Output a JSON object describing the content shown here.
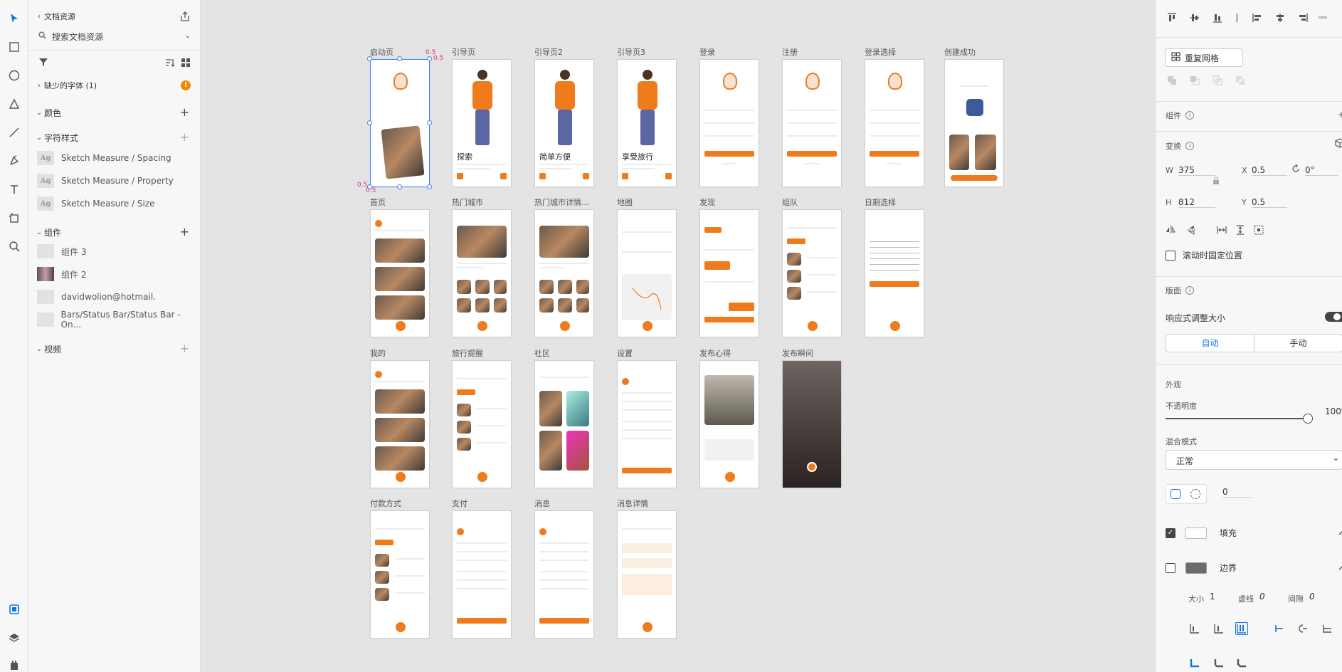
{
  "left_panel": {
    "header_title": "文档资源",
    "search_placeholder": "搜索文档资源",
    "missing_fonts": "缺少的字体 (1)",
    "missing_badge": "!",
    "colors_section": "颜色",
    "text_styles_section": "字符样式",
    "text_styles": [
      "Sketch Measure / Spacing",
      "Sketch Measure / Property",
      "Sketch Measure / Size"
    ],
    "text_style_thumb": "Ag",
    "components_section": "组件",
    "components": [
      "组件 3",
      "组件 2",
      "davidwolion@hotmail.",
      "Bars/Status Bar/Status Bar - On..."
    ],
    "video_section": "视频"
  },
  "canvas": {
    "artboards": [
      {
        "label": "启动页",
        "kind": "splash"
      },
      {
        "label": "引导页",
        "kind": "guide",
        "title": "探索"
      },
      {
        "label": "引导页2",
        "kind": "guide",
        "title": "简单方便"
      },
      {
        "label": "引导页3",
        "kind": "guide",
        "title": "享受旅行"
      },
      {
        "label": "登录",
        "kind": "login"
      },
      {
        "label": "注册",
        "kind": "login"
      },
      {
        "label": "登录选择",
        "kind": "login"
      },
      {
        "label": "创建成功",
        "kind": "success"
      },
      {
        "label": "首页",
        "kind": "feed"
      },
      {
        "label": "热门城市",
        "kind": "grid"
      },
      {
        "label": "热门城市详情...",
        "kind": "detail"
      },
      {
        "label": "地图",
        "kind": "map"
      },
      {
        "label": "发现",
        "kind": "discover"
      },
      {
        "label": "组队",
        "kind": "list"
      },
      {
        "label": "日期选择",
        "kind": "calendar"
      },
      {
        "label": "我的",
        "kind": "profile"
      },
      {
        "label": "旅行提醒",
        "kind": "list"
      },
      {
        "label": "社区",
        "kind": "community"
      },
      {
        "label": "设置",
        "kind": "settings"
      },
      {
        "label": "发布心得",
        "kind": "post"
      },
      {
        "label": "发布瞬间",
        "kind": "camera"
      },
      {
        "label": "付款方式",
        "kind": "list"
      },
      {
        "label": "支付",
        "kind": "settings"
      },
      {
        "label": "消息",
        "kind": "settings"
      },
      {
        "label": "消息详情",
        "kind": "chat"
      }
    ],
    "selection_labels": {
      "top": "0.5",
      "corner": "0.5",
      "left": "0.5",
      "bottom": "0.5"
    }
  },
  "right_panel": {
    "repeat_grid": "重复网格",
    "component_label": "组件",
    "transform_label": "变换",
    "w_label": "W",
    "w_value": "375",
    "x_label": "X",
    "x_value": "0.5",
    "rotation_value": "0°",
    "h_label": "H",
    "h_value": "812",
    "y_label": "Y",
    "y_value": "0.5",
    "fix_on_scroll": "滚动时固定位置",
    "layout_label": "版面",
    "responsive_resize": "响应式调整大小",
    "auto_tab": "自动",
    "manual_tab": "手动",
    "appearance_label": "外观",
    "opacity_label": "不透明度",
    "opacity_value": "100%",
    "blend_label": "混合模式",
    "blend_value": "正常",
    "corner_value": "0",
    "fill_label": "填充",
    "border_label": "边界",
    "size_label": "大小",
    "size_value": "1",
    "dash_label": "虚线",
    "dash_value": "0",
    "gap_label": "间隙",
    "gap_value": "0"
  },
  "colors": {
    "accent": "#f07b1d",
    "selection": "#3b82f6",
    "tool_active": "#1473e6",
    "warning": "#f08c00"
  }
}
